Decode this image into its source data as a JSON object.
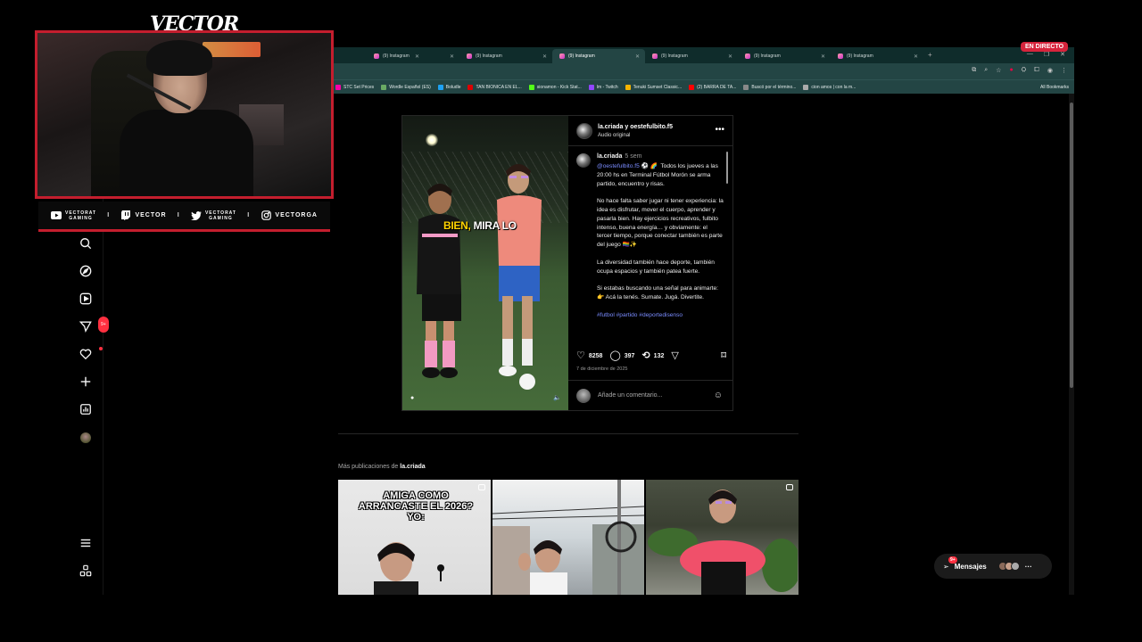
{
  "stream": {
    "logo": "VECTOR",
    "live_badge": "EN DIRECTO",
    "socials": [
      {
        "icon": "youtube-icon",
        "top": "VECTORAT",
        "bottom": "GAMING"
      },
      {
        "icon": "twitch-icon",
        "label": "VECTOR"
      },
      {
        "icon": "twitter-icon",
        "top": "VECTORAT",
        "bottom": "GAMING"
      },
      {
        "icon": "instagram-icon",
        "label": "VECTORGA"
      }
    ],
    "separator": "I"
  },
  "browser": {
    "tabs": [
      {
        "label": "(9) Instagram"
      },
      {
        "label": "(9) Instagram"
      },
      {
        "label": "(9) Instagram"
      },
      {
        "label": "(9) Instagram"
      },
      {
        "label": "(9) Instagram"
      },
      {
        "label": "(9) Instagram"
      }
    ],
    "add_tab": "+",
    "bookmarks": [
      {
        "label": "STC Set Prices",
        "color": "#f0a"
      },
      {
        "label": "Wordle Español (ES)",
        "color": "#6aaa64"
      },
      {
        "label": "Boludle",
        "color": "#1da1f2"
      },
      {
        "label": "TAN BIONICA EN EL...",
        "color": "#d00"
      },
      {
        "label": "sionamon - Kick Stat...",
        "color": "#53fc18"
      },
      {
        "label": "lm - Twitch",
        "color": "#9146ff"
      },
      {
        "label": "Tenuki Sumset Classic...",
        "color": "#f5b400"
      },
      {
        "label": "(2) BARRA DE TA...",
        "color": "#f00"
      },
      {
        "label": "Buscó por el término...",
        "color": "#888"
      },
      {
        "label": "cion amos | con la m...",
        "color": "#aaa"
      }
    ],
    "all_bookmarks": "All Bookmarks"
  },
  "sidebar": {
    "badge_notifications": "9+"
  },
  "post": {
    "header_user": "la.criada y oestefulbito.f5",
    "header_audio": "Audio original",
    "overlay_yellow": "BIEN,",
    "overlay_white": "MIRA LO",
    "caption_user": "la.criada",
    "caption_time": "5 sem",
    "caption_mention": "@oestefulbito.f5",
    "caption_body": " ⚽ 🌈  Todos los jueves a las 20:00 hs en Terminal Fútbol Morón se arma partido, encuentro y risas.\n\nNo hace falta saber jugar ni tener experiencia: la idea es disfrutar, mover el cuerpo, aprender y pasarla bien. Hay ejercicios recreativos, fulbito intenso, buena energía… y obviamente: el tercer tiempo, porque conectar también es parte del juego 🏳️‍🌈✨\n\nLa diversidad también hace deporte, también ocupa espacios y también patea fuerte.\n\nSi estabas buscando una señal para animarte:\n👉 Acá la tenés. Sumate. Jugá. Divertite.\n\n",
    "caption_hashtags": "#futbol #partido #deportedisenso",
    "likes": "8258",
    "comments": "397",
    "reposts": "132",
    "date": "7 de diciembre de 2025",
    "comment_placeholder": "Añade un comentario..."
  },
  "more_posts": {
    "prefix": "Más publicaciones de ",
    "user": "la.criada",
    "thumb1_text": "AMIGA COMO ARRANCASTE EL 2026? YO:"
  },
  "messages": {
    "label": "Mensajes",
    "badge": "9+"
  }
}
